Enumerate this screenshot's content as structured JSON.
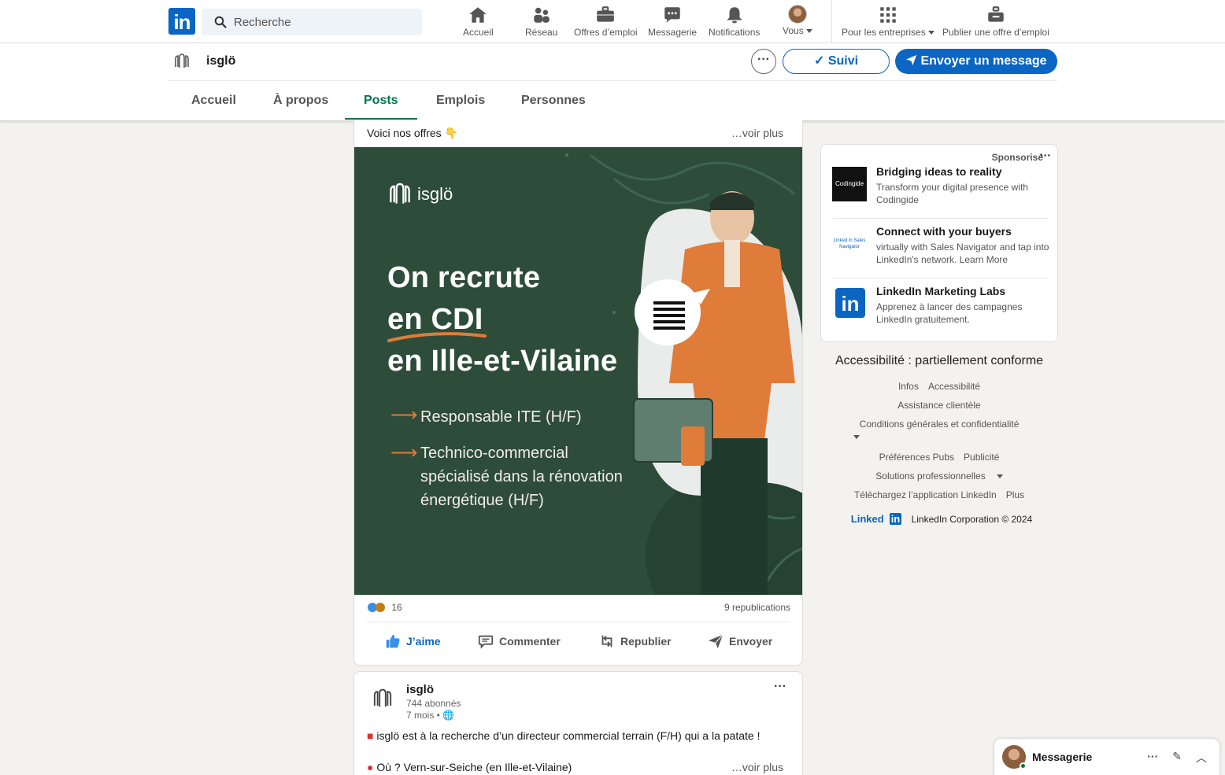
{
  "topbar": {
    "search_placeholder": "Recherche",
    "nav": [
      {
        "label": "Accueil",
        "icon": "home-icon"
      },
      {
        "label": "Réseau",
        "icon": "network-icon"
      },
      {
        "label": "Offres d’emploi",
        "icon": "briefcase-icon"
      },
      {
        "label": "Messagerie",
        "icon": "chat-icon"
      },
      {
        "label": "Notifications",
        "icon": "bell-icon"
      },
      {
        "label": "Vous",
        "icon": "avatar"
      }
    ],
    "business_label": "Pour les entreprises",
    "post_job_label": "Publier une offre d’emploi"
  },
  "company": {
    "name": "isglö",
    "more": "···",
    "follow_label": "Suivi",
    "message_label": "Envoyer un message",
    "tabs": [
      "Accueil",
      "À propos",
      "Posts",
      "Emplois",
      "Personnes"
    ],
    "active_tab": "Posts"
  },
  "post1": {
    "text": "Voici nos offres 👇",
    "see_more": "…voir plus",
    "banner": {
      "brand": "isglö",
      "title_lines": [
        "On recrute",
        "en CDI",
        "en Ille-et-Vilaine"
      ],
      "job1": "Responsable ITE (H/F)",
      "job2_lines": [
        "Technico-commercial",
        "spécialisé dans la rénovation",
        "énergétique (H/F)"
      ]
    },
    "reactions_count": "16",
    "reposts": "9 republications",
    "actions": [
      "J’aime",
      "Commenter",
      "Republier",
      "Envoyer"
    ]
  },
  "post2": {
    "author": "isglö",
    "followers": "744 abonnés",
    "age": "7 mois •",
    "line1": "isglö est à la recherche d’un directeur commercial terrain (F/H) qui a la patate !",
    "line2": "Où ? Vern-sur-Seiche (en Ille-et-Vilaine)",
    "see_more": "…voir plus",
    "more": "···"
  },
  "ads": {
    "sponsored": "Sponsorisé",
    "dots": "···",
    "items": [
      {
        "title": "Bridging ideas to reality",
        "desc": "Transform your digital presence with Codingide",
        "thumb_text": "Codingide"
      },
      {
        "title": "Connect with your buyers",
        "desc": "virtually with Sales Navigator and tap into LinkedIn's network. Learn More",
        "thumb_text": "Linked in Sales Navigator"
      },
      {
        "title": "LinkedIn Marketing Labs",
        "desc": "Apprenez à lancer des campagnes LinkedIn gratuitement.",
        "thumb_text": "in"
      }
    ]
  },
  "footer": {
    "accessibility": "Accessibilité : partiellement conforme",
    "links": [
      "Infos",
      "Accessibilité",
      "Assistance clientèle",
      "Conditions générales et confidentialité",
      "Préférences Pubs",
      "Publicité",
      "Solutions professionnelles",
      "Téléchargez l’application LinkedIn",
      "Plus"
    ],
    "copyright": "LinkedIn Corporation © 2024",
    "brand": "Linked"
  },
  "messaging": {
    "title": "Messagerie"
  },
  "colors": {
    "brand_blue": "#0a66c2",
    "active_green": "#01754f",
    "banner_green": "#2d4d3a",
    "accent_orange": "#e07c3a"
  }
}
